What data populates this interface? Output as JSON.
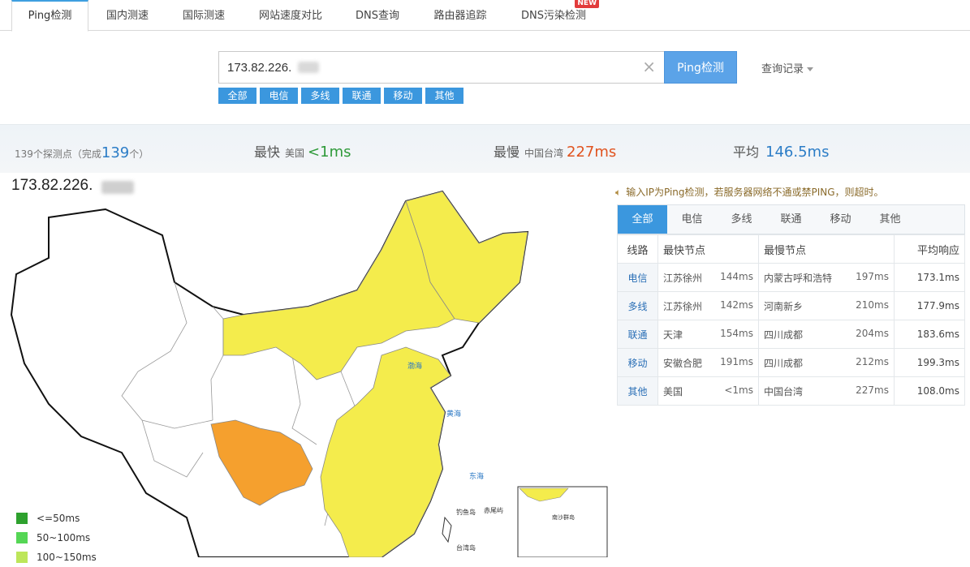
{
  "tabs": [
    {
      "label": "Ping检测",
      "active": true
    },
    {
      "label": "国内测速"
    },
    {
      "label": "国际测速"
    },
    {
      "label": "网站速度对比"
    },
    {
      "label": "DNS查询"
    },
    {
      "label": "路由器追踪"
    },
    {
      "label": "DNS污染检测",
      "badge": "NEW"
    }
  ],
  "search": {
    "value": "173.82.226.",
    "button": "Ping检测",
    "history": "查询记录"
  },
  "filters": [
    "全部",
    "电信",
    "多线",
    "联通",
    "移动",
    "其他"
  ],
  "stats": {
    "probe_prefix": "139个探测点（完成",
    "probe_done": "139",
    "probe_suffix": "个）",
    "fastest_label": "最快",
    "fastest_loc": "美国",
    "fastest_value": "<1ms",
    "slowest_label": "最慢",
    "slowest_loc": "中国台湾",
    "slowest_value": "227ms",
    "avg_label": "平均",
    "avg_value": "146.5ms"
  },
  "ip_title": "173.82.226.",
  "notice": "输入IP为Ping检测，若服务器网络不通或禁PING，则超时。",
  "result_tabs": [
    "全部",
    "电信",
    "多线",
    "联通",
    "移动",
    "其他"
  ],
  "table": {
    "headers": [
      "线路",
      "最快节点",
      "最慢节点",
      "平均响应"
    ],
    "rows": [
      {
        "line": "电信",
        "fast_loc": "江苏徐州",
        "fast_ms": "144ms",
        "slow_loc": "内蒙古呼和浩特",
        "slow_ms": "197ms",
        "avg": "173.1ms"
      },
      {
        "line": "多线",
        "fast_loc": "江苏徐州",
        "fast_ms": "142ms",
        "slow_loc": "河南新乡",
        "slow_ms": "210ms",
        "avg": "177.9ms"
      },
      {
        "line": "联通",
        "fast_loc": "天津",
        "fast_ms": "154ms",
        "slow_loc": "四川成都",
        "slow_ms": "204ms",
        "avg": "183.6ms"
      },
      {
        "line": "移动",
        "fast_loc": "安徽合肥",
        "fast_ms": "191ms",
        "slow_loc": "四川成都",
        "slow_ms": "212ms",
        "avg": "199.3ms"
      },
      {
        "line": "其他",
        "fast_loc": "美国",
        "fast_ms": "<1ms",
        "slow_loc": "中国台湾",
        "slow_ms": "227ms",
        "avg": "108.0ms"
      }
    ]
  },
  "legend": [
    {
      "label": "<=50ms",
      "color": "#2ea12e"
    },
    {
      "label": "50~100ms",
      "color": "#55d655"
    },
    {
      "label": "100~150ms",
      "color": "#bde65a"
    }
  ],
  "map_labels": {
    "bohai": "渤海",
    "yellow_sea": "黄海",
    "east_sea": "东海",
    "diaoyu": "钓鱼岛",
    "chiwei": "赤尾屿",
    "taiwan": "台湾岛",
    "nansha": "南沙群岛"
  },
  "colors": {
    "accent": "#3b97de",
    "fast_green": "#2f9a3a",
    "slow_red": "#e0531f",
    "avg_blue": "#2c7dc7",
    "map_yellow": "#f4ec4c",
    "map_orange": "#f5a02e"
  }
}
